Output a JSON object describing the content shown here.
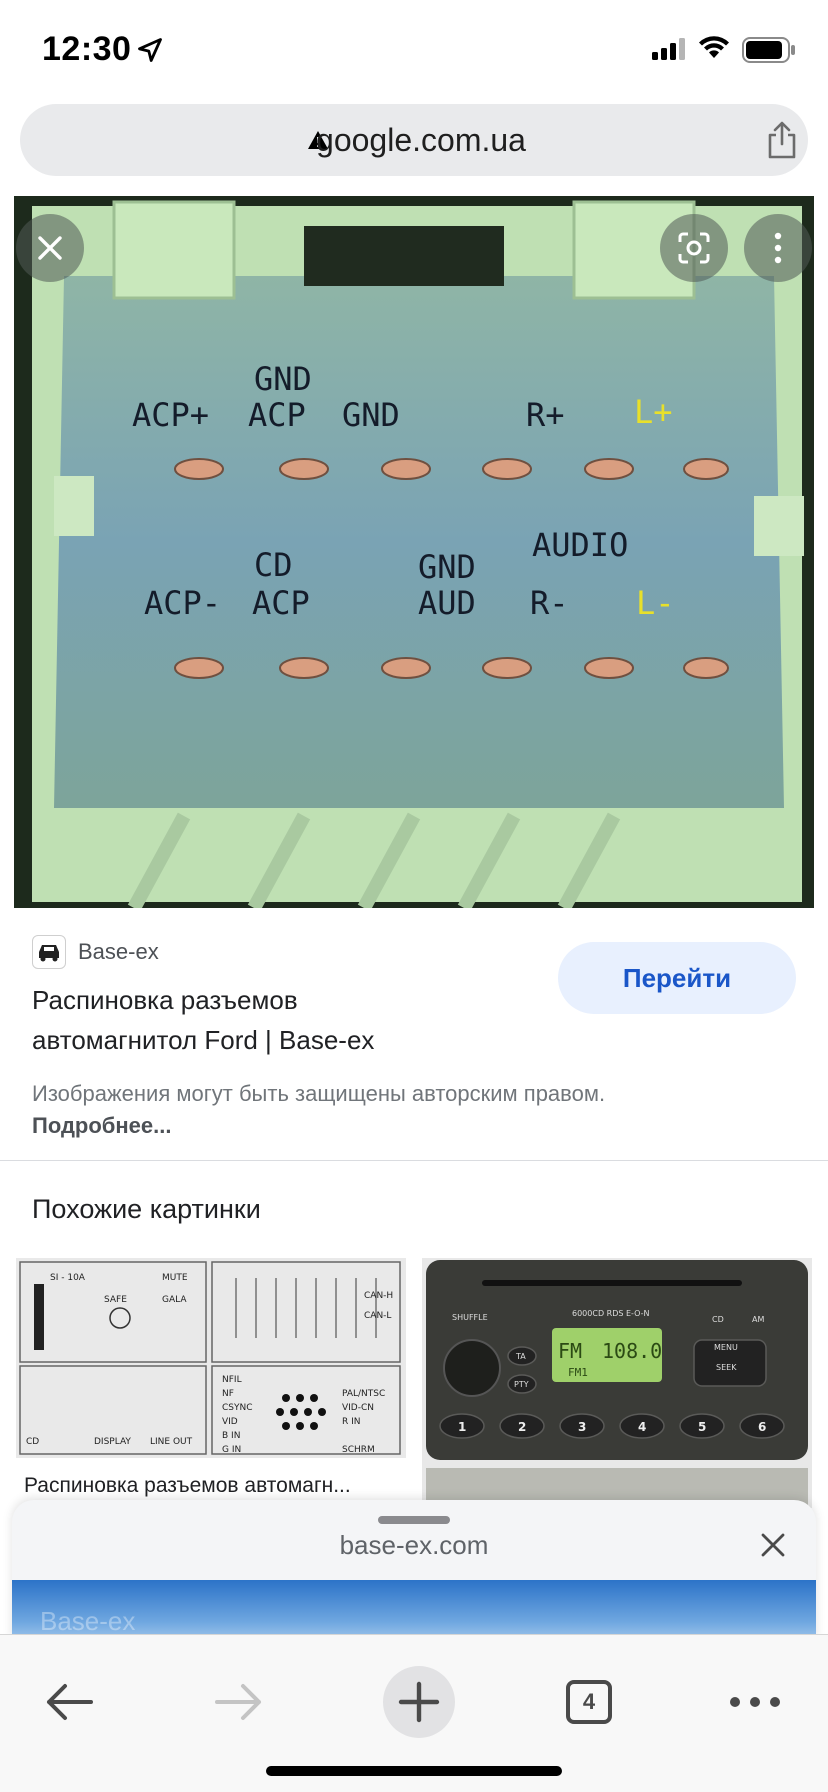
{
  "status": {
    "time": "12:30"
  },
  "url_bar": {
    "domain": "google.com.ua"
  },
  "image": {
    "pin_labels_top": [
      "ACP+",
      "GND",
      "ACP",
      "GND",
      "R+",
      "L+"
    ],
    "pin_labels_bottom": [
      "ACP-",
      "CD",
      "ACP",
      "GND",
      "AUD",
      "AUDIO",
      "R-",
      "L-"
    ]
  },
  "result": {
    "source": "Base-ex",
    "title_line1": "Распиновка разъемов",
    "title_line2": "автомагнитол Ford | Base-ex",
    "go_button": "Перейти",
    "copyright_text": "Изображения могут быть защищены авторским правом.",
    "copyright_link": "Подробнее..."
  },
  "similar": {
    "heading": "Похожие картинки",
    "items": [
      {
        "caption": "Распиновка разъемов автомагн...",
        "labels": [
          "CD",
          "DISPLAY",
          "LINE OUT",
          "SI - 10A",
          "SAFE",
          "MUTE",
          "GALA",
          "NFIL",
          "NF",
          "CSYNC",
          "VID",
          "B IN",
          "G IN",
          "R IN",
          "PAL/NTSC",
          "VID-CN",
          "SCHRM",
          "CAN-H",
          "CAN-L"
        ]
      },
      {
        "caption": "",
        "labels": [
          "FM",
          "108.0",
          "FM1",
          "6000CD RDS E-O-N",
          "SHUFFLE",
          "TA",
          "PTY",
          "MENU",
          "SEEK",
          "CD",
          "AM",
          "1",
          "2",
          "3",
          "4",
          "5",
          "6"
        ]
      }
    ]
  },
  "sheet": {
    "domain": "base-ex.com",
    "preview_text": "Base-ex"
  },
  "toolbar": {
    "tab_count": "4"
  }
}
